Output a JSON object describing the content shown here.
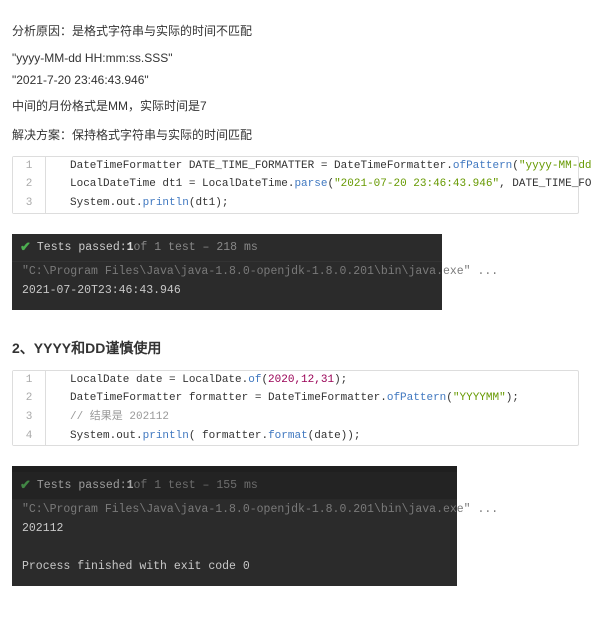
{
  "p1": "分析原因：是格式字符串与实际的时间不匹配",
  "q1": "\"yyyy-MM-dd HH:mm:ss.SSS\"",
  "q2": "\"2021-7-20 23:46:43.946\"",
  "p2": "中间的月份格式是MM，实际时间是7",
  "p3": "解决方案：保持格式字符串与实际的时间匹配",
  "code1": {
    "lines": [
      {
        "n": "1",
        "pre": "DateTimeFormatter DATE_TIME_FORMATTER = DateTimeFormatter.",
        "m": "ofPattern",
        "open": "(",
        "s": "\"yyyy-MM-dd HH:mm:ss.SSS\"",
        "close": ");"
      },
      {
        "n": "2",
        "pre": "LocalDateTime dt1 = LocalDateTime.",
        "m": "parse",
        "open": "(",
        "s": "\"2021-07-20 23:46:43.946\"",
        "mid": ", DATE_TIME_FORMATTER",
        "close": ");"
      },
      {
        "n": "3",
        "pre": "System.out.",
        "m": "println",
        "open": "(dt1",
        "close": ");"
      }
    ]
  },
  "console1": {
    "passed_label": "Tests passed:",
    "passed_count": " 1 ",
    "passed_rest": "of 1 test – 218 ms",
    "cmd": "\"C:\\Program Files\\Java\\java-1.8.0-openjdk-1.8.0.201\\bin\\java.exe\" ...",
    "out": "2021-07-20T23:46:43.946"
  },
  "section2": "2、YYYY和DD谨慎使用",
  "code2": {
    "lines": [
      {
        "n": "1",
        "pre": "LocalDate date = LocalDate.",
        "m": "of",
        "open": "(",
        "nums": "2020,12,31",
        "close": ");"
      },
      {
        "n": "2",
        "pre": "DateTimeFormatter formatter = DateTimeFormatter.",
        "m": "ofPattern",
        "open": "(",
        "s": "\"YYYYMM\"",
        "close": ");"
      },
      {
        "n": "3",
        "comment": "// 结果是 202112"
      },
      {
        "n": "4",
        "pre": "System.out.",
        "m": "println",
        "open": "( formatter.",
        "m2": "format",
        "open2": "(date)",
        "close": ");"
      }
    ]
  },
  "console2": {
    "passed_label": "Tests passed:",
    "passed_count": " 1 ",
    "passed_rest": "of 1 test – 155 ms",
    "cmd": "\"C:\\Program Files\\Java\\java-1.8.0-openjdk-1.8.0.201\\bin\\java.exe\" ...",
    "out1": "202112",
    "blank": " ",
    "out2": "Process finished with exit code 0"
  }
}
